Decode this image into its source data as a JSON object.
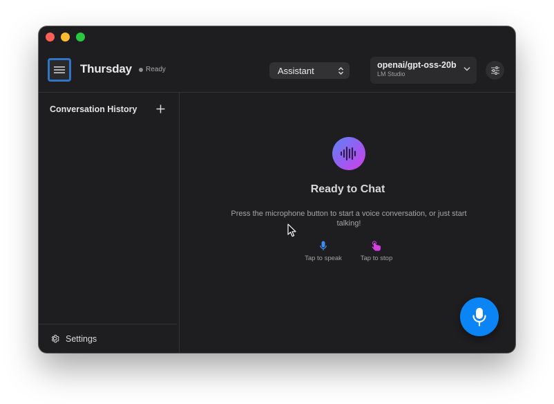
{
  "app": {
    "title": "Thursday",
    "status": "Ready"
  },
  "header": {
    "mode_selected": "Assistant",
    "model": {
      "name": "openai/gpt-oss-20b",
      "provider": "LM Studio"
    }
  },
  "sidebar": {
    "title": "Conversation History",
    "footer_label": "Settings"
  },
  "main": {
    "title": "Ready to Chat",
    "description": "Press the microphone button to start a voice conversation, or just start talking!",
    "hints": [
      {
        "label": "Tap to speak",
        "icon": "mic-icon",
        "color": "#3b8ef5"
      },
      {
        "label": "Tap to stop",
        "icon": "hand-tap-icon",
        "color": "#d43fe0"
      }
    ]
  },
  "colors": {
    "accent": "#0b84f5",
    "window_bg": "#1e1e20",
    "focus_ring": "#2f76c8"
  }
}
